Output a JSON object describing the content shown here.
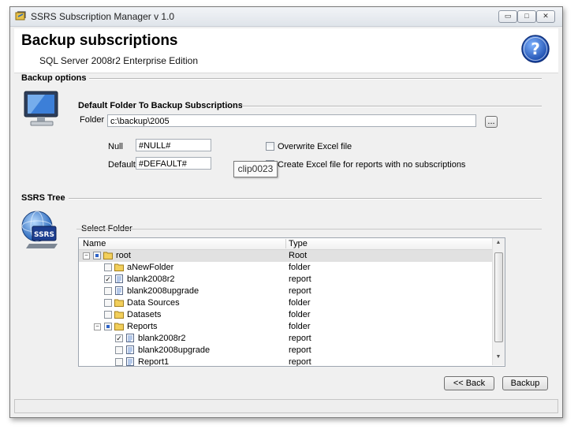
{
  "window": {
    "title": "SSRS Subscription Manager v 1.0",
    "controls": {
      "minimize": "▭",
      "maximize": "□",
      "close": "✕"
    }
  },
  "header": {
    "title": "Backup subscriptions",
    "subtitle": "SQL Server 2008r2 Enterprise Edition"
  },
  "backup_options": {
    "section_title": "Backup options",
    "group_title": "Default Folder To Backup Subscriptions",
    "folder_label": "Folder",
    "folder_value": "c:\\backup\\2005",
    "browse_label": "...",
    "null_label": "Null",
    "null_value": "#NULL#",
    "default_label": "Default",
    "default_value": "#DEFAULT#",
    "overwrite_label": "Overwrite Excel file",
    "create_excel_label": "Create Excel file for reports with no subscriptions",
    "tooltip": "clip0023"
  },
  "ssrs_tree": {
    "section_title": "SSRS Tree",
    "group_title": "Select Folder",
    "columns": {
      "name": "Name",
      "type": "Type"
    },
    "rows": [
      {
        "name": "root",
        "type": "Root",
        "level": 0,
        "toggle": "−",
        "checked": "partial",
        "icon": "folder",
        "selected": true
      },
      {
        "name": "aNewFolder",
        "type": "folder",
        "level": 1,
        "toggle": "",
        "checked": "no",
        "icon": "folder"
      },
      {
        "name": "blank2008r2",
        "type": "report",
        "level": 1,
        "toggle": "",
        "checked": "yes",
        "icon": "report"
      },
      {
        "name": "blank2008upgrade",
        "type": "report",
        "level": 1,
        "toggle": "",
        "checked": "no",
        "icon": "report"
      },
      {
        "name": "Data Sources",
        "type": "folder",
        "level": 1,
        "toggle": "",
        "checked": "no",
        "icon": "folder"
      },
      {
        "name": "Datasets",
        "type": "folder",
        "level": 1,
        "toggle": "",
        "checked": "no",
        "icon": "folder"
      },
      {
        "name": "Reports",
        "type": "folder",
        "level": 1,
        "toggle": "−",
        "checked": "partial",
        "icon": "folder"
      },
      {
        "name": "blank2008r2",
        "type": "report",
        "level": 2,
        "toggle": "",
        "checked": "yes",
        "icon": "report"
      },
      {
        "name": "blank2008upgrade",
        "type": "report",
        "level": 2,
        "toggle": "",
        "checked": "no",
        "icon": "report"
      },
      {
        "name": "Report1",
        "type": "report",
        "level": 2,
        "toggle": "",
        "checked": "no",
        "icon": "report"
      }
    ]
  },
  "buttons": {
    "back": "<< Back",
    "backup": "Backup"
  },
  "colors": {
    "folder": "#f2cf5b",
    "accent": "#1e5fb4"
  }
}
